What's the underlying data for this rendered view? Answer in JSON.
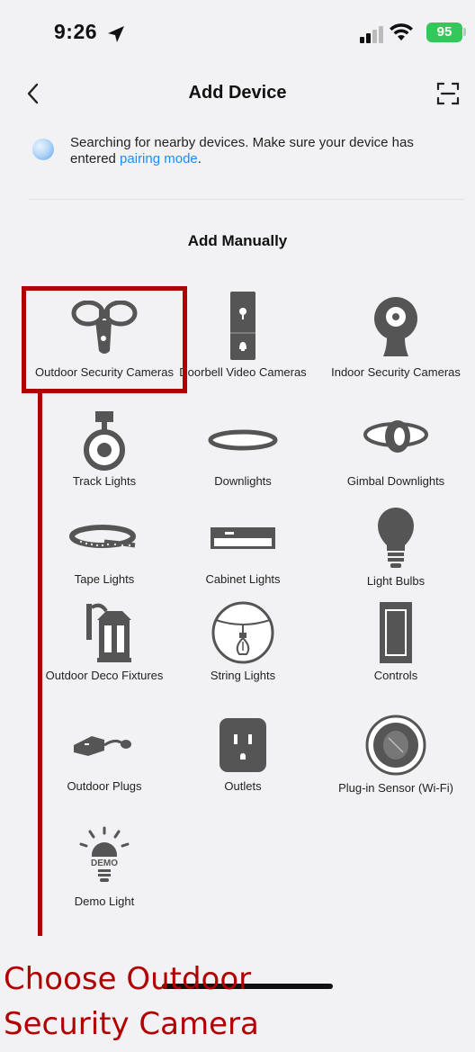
{
  "status_bar": {
    "time": "9:26",
    "battery": "95"
  },
  "nav": {
    "title": "Add Device"
  },
  "searching": {
    "text_before": "Searching for nearby devices. Make sure your device has entered ",
    "link": "pairing mode",
    "text_after": "."
  },
  "section_title": "Add Manually",
  "devices": [
    {
      "label": "Outdoor Security Cameras",
      "icon": "outdoor-camera-icon"
    },
    {
      "label": "Doorbell Video Cameras",
      "icon": "doorbell-camera-icon"
    },
    {
      "label": "Indoor Security Cameras",
      "icon": "indoor-camera-icon"
    },
    {
      "label": "Track Lights",
      "icon": "track-light-icon"
    },
    {
      "label": "Downlights",
      "icon": "downlight-icon"
    },
    {
      "label": "Gimbal Downlights",
      "icon": "gimbal-downlight-icon"
    },
    {
      "label": "Tape Lights",
      "icon": "tape-light-icon"
    },
    {
      "label": "Cabinet Lights",
      "icon": "cabinet-light-icon"
    },
    {
      "label": "Light Bulbs",
      "icon": "light-bulb-icon"
    },
    {
      "label": "Outdoor Deco Fixtures",
      "icon": "outdoor-lantern-icon"
    },
    {
      "label": "String Lights",
      "icon": "string-light-icon"
    },
    {
      "label": "Controls",
      "icon": "switch-control-icon"
    },
    {
      "label": "Outdoor Plugs",
      "icon": "outdoor-plug-icon"
    },
    {
      "label": "Outlets",
      "icon": "outlet-icon"
    },
    {
      "label": "Plug-in Sensor (Wi-Fi)",
      "icon": "plugin-sensor-icon"
    },
    {
      "label": "Demo Light",
      "icon": "demo-light-icon",
      "badge": "DEMO"
    }
  ],
  "annotation": {
    "line1": "Choose Outdoor",
    "line2": "Security Camera"
  },
  "colors": {
    "accent_link": "#1a8cff",
    "annotation": "#b00000",
    "battery": "#34c759",
    "icon_gray": "#555555"
  }
}
